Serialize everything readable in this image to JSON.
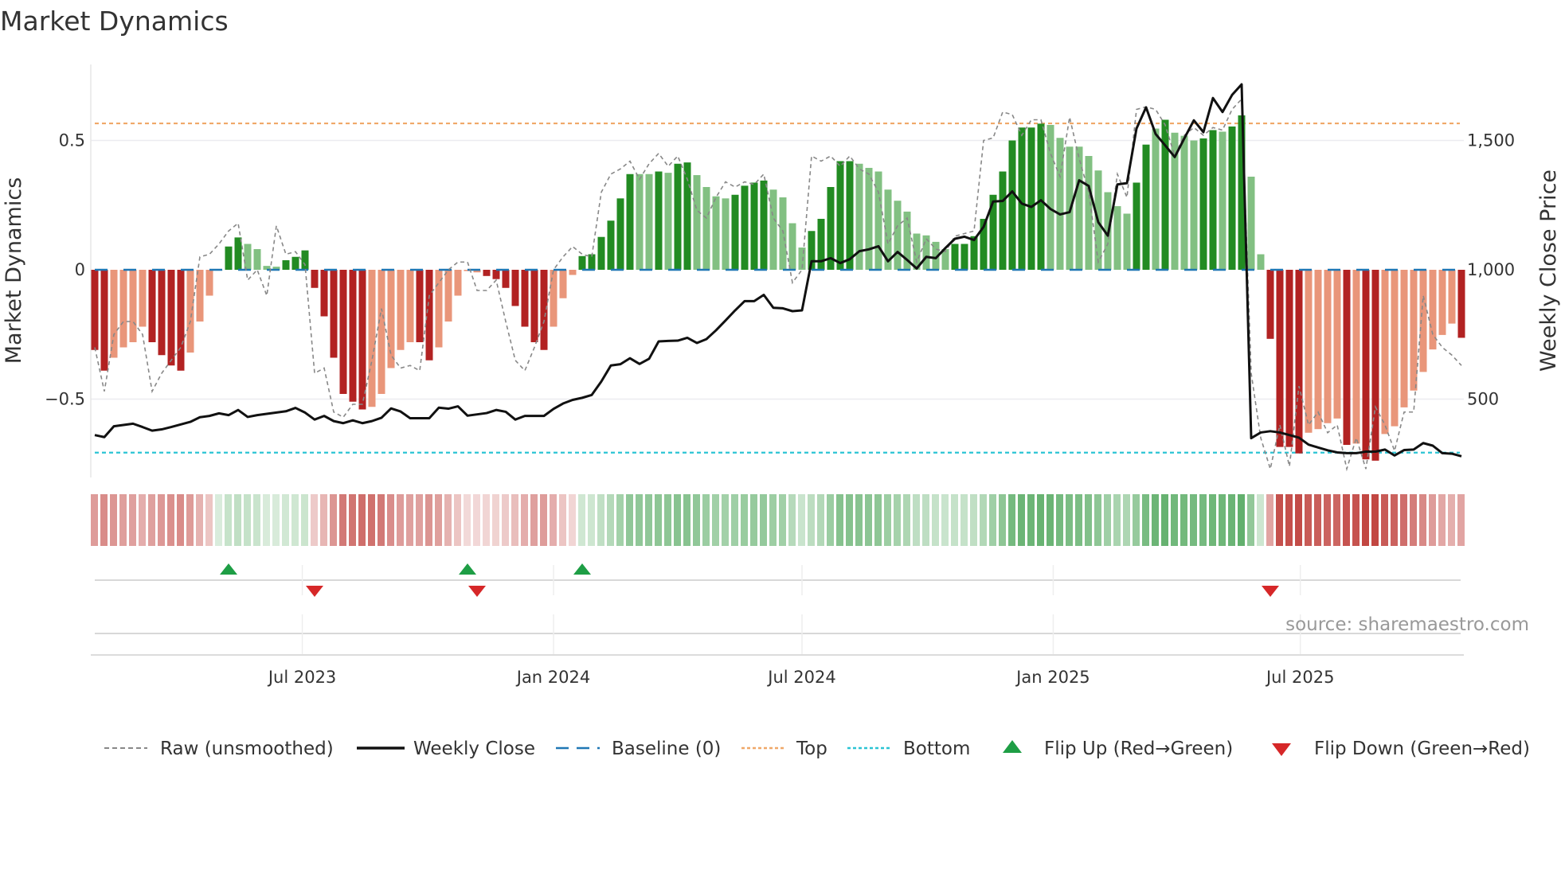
{
  "title": "Market Dynamics",
  "source": "source: sharemaestro.com",
  "chart_data": {
    "type": "bar",
    "title": "Market Dynamics",
    "ylabel": "Market Dynamics",
    "y2label": "Weekly Close Price",
    "ylim": [
      -0.82,
      0.8
    ],
    "y2lim": [
      180,
      1800
    ],
    "yticks": [
      {
        "v": 0.5,
        "label": "0.5"
      },
      {
        "v": 0,
        "label": "0"
      },
      {
        "v": -0.5,
        "label": "−0.5"
      }
    ],
    "y2ticks": [
      {
        "v": 1500,
        "label": "1,500"
      },
      {
        "v": 1000,
        "label": "1,000"
      },
      {
        "v": 500,
        "label": "500"
      }
    ],
    "start_date": "2023-01-30",
    "frequency": "weekly",
    "xticks": [
      {
        "date": "2023-07-01",
        "label": "Jul 2023"
      },
      {
        "date": "2024-01-01",
        "label": "Jan 2024"
      },
      {
        "date": "2024-07-01",
        "label": "Jul 2024"
      },
      {
        "date": "2025-01-01",
        "label": "Jan 2025"
      },
      {
        "date": "2025-07-01",
        "label": "Jul 2025"
      }
    ],
    "top": 0.566,
    "bottom": -0.707,
    "values": [
      -0.31,
      -0.39,
      -0.34,
      -0.3,
      -0.28,
      -0.22,
      -0.28,
      -0.33,
      -0.37,
      -0.39,
      -0.32,
      -0.2,
      -0.1,
      0.0,
      0.09,
      0.125,
      0.1,
      0.08,
      0.015,
      0.012,
      0.037,
      0.05,
      0.075,
      -0.07,
      -0.18,
      -0.34,
      -0.48,
      -0.51,
      -0.54,
      -0.53,
      -0.48,
      -0.38,
      -0.31,
      -0.28,
      -0.28,
      -0.35,
      -0.3,
      -0.2,
      -0.1,
      -0.005,
      -0.01,
      -0.024,
      -0.036,
      -0.07,
      -0.14,
      -0.22,
      -0.28,
      -0.31,
      -0.22,
      -0.11,
      -0.02,
      0.053,
      0.06,
      0.127,
      0.19,
      0.276,
      0.37,
      0.37,
      0.37,
      0.38,
      0.375,
      0.41,
      0.415,
      0.366,
      0.32,
      0.284,
      0.276,
      0.29,
      0.325,
      0.337,
      0.345,
      0.31,
      0.28,
      0.18,
      0.086,
      0.15,
      0.197,
      0.32,
      0.42,
      0.42,
      0.41,
      0.394,
      0.38,
      0.31,
      0.267,
      0.225,
      0.14,
      0.133,
      0.108,
      0.08,
      0.1,
      0.1,
      0.13,
      0.197,
      0.29,
      0.38,
      0.5,
      0.55,
      0.55,
      0.565,
      0.56,
      0.51,
      0.476,
      0.476,
      0.44,
      0.384,
      0.3,
      0.246,
      0.217,
      0.337,
      0.484,
      0.546,
      0.58,
      0.53,
      0.518,
      0.5,
      0.508,
      0.54,
      0.534,
      0.554,
      0.597,
      0.36,
      0.06,
      -0.267,
      -0.685,
      -0.685,
      -0.71,
      -0.63,
      -0.616,
      -0.593,
      -0.575,
      -0.677,
      -0.672,
      -0.733,
      -0.738,
      -0.635,
      -0.605,
      -0.532,
      -0.467,
      -0.395,
      -0.308,
      -0.252,
      -0.208,
      -0.263
    ],
    "strengthening": [
      1,
      1,
      0,
      0,
      0,
      0,
      1,
      1,
      1,
      1,
      0,
      0,
      0,
      0,
      1,
      1,
      0,
      0,
      0,
      0,
      1,
      1,
      1,
      1,
      1,
      1,
      1,
      1,
      1,
      0,
      0,
      0,
      0,
      0,
      1,
      1,
      0,
      0,
      0,
      0,
      0,
      1,
      1,
      1,
      1,
      1,
      1,
      1,
      0,
      0,
      0,
      1,
      1,
      1,
      1,
      1,
      1,
      0,
      0,
      1,
      0,
      1,
      1,
      0,
      0,
      0,
      0,
      1,
      1,
      1,
      1,
      0,
      0,
      0,
      0,
      1,
      1,
      1,
      1,
      1,
      0,
      0,
      0,
      0,
      0,
      0,
      0,
      0,
      0,
      0,
      1,
      1,
      1,
      1,
      1,
      1,
      1,
      1,
      1,
      1,
      0,
      0,
      0,
      0,
      0,
      0,
      0,
      0,
      0,
      1,
      1,
      0,
      1,
      0,
      0,
      0,
      1,
      1,
      0,
      1,
      1,
      0,
      0,
      1,
      1,
      1,
      1,
      0,
      0,
      0,
      0,
      1,
      0,
      1,
      1,
      0,
      0,
      0,
      0,
      0,
      0,
      0,
      0,
      1
    ],
    "raw": [
      -0.3,
      -0.47,
      -0.25,
      -0.2,
      -0.2,
      -0.25,
      -0.47,
      -0.4,
      -0.35,
      -0.3,
      -0.2,
      0.05,
      0.06,
      0.1,
      0.15,
      0.18,
      -0.04,
      0.0,
      -0.1,
      0.17,
      0.06,
      0.07,
      0.02,
      -0.4,
      -0.38,
      -0.55,
      -0.57,
      -0.52,
      -0.52,
      -0.35,
      -0.15,
      -0.33,
      -0.38,
      -0.37,
      -0.39,
      -0.1,
      -0.05,
      0.0,
      0.03,
      0.03,
      -0.08,
      -0.08,
      -0.04,
      -0.2,
      -0.35,
      -0.39,
      -0.3,
      -0.2,
      0.0,
      0.05,
      0.09,
      0.06,
      0.05,
      0.3,
      0.37,
      0.39,
      0.42,
      0.35,
      0.41,
      0.45,
      0.4,
      0.44,
      0.35,
      0.23,
      0.2,
      0.28,
      0.34,
      0.32,
      0.34,
      0.33,
      0.37,
      0.2,
      0.15,
      -0.05,
      0.0,
      0.44,
      0.42,
      0.44,
      0.4,
      0.44,
      0.39,
      0.37,
      0.3,
      0.1,
      0.17,
      0.2,
      0.03,
      0.12,
      0.08,
      0.07,
      0.13,
      0.14,
      0.15,
      0.5,
      0.51,
      0.61,
      0.6,
      0.52,
      0.58,
      0.58,
      0.45,
      0.36,
      0.59,
      0.43,
      0.3,
      0.03,
      0.1,
      0.37,
      0.28,
      0.62,
      0.63,
      0.62,
      0.56,
      0.44,
      0.52,
      0.55,
      0.52,
      0.55,
      0.54,
      0.62,
      0.66,
      -0.4,
      -0.65,
      -0.77,
      -0.6,
      -0.76,
      -0.45,
      -0.6,
      -0.55,
      -0.63,
      -0.6,
      -0.77,
      -0.65,
      -0.77,
      -0.53,
      -0.6,
      -0.7,
      -0.55,
      -0.55,
      -0.1,
      -0.25,
      -0.3,
      -0.33,
      -0.37
    ],
    "close": [
      361,
      353,
      395,
      400,
      405,
      392,
      378,
      383,
      392,
      402,
      412,
      430,
      435,
      445,
      438,
      458,
      431,
      438,
      443,
      448,
      453,
      466,
      448,
      421,
      435,
      415,
      407,
      418,
      407,
      415,
      428,
      464,
      452,
      426,
      426,
      426,
      467,
      463,
      472,
      436,
      441,
      446,
      458,
      451,
      421,
      435,
      435,
      435,
      462,
      483,
      497,
      505,
      516,
      568,
      630,
      635,
      658,
      636,
      656,
      723,
      725,
      726,
      737,
      717,
      732,
      766,
      804,
      843,
      879,
      879,
      903,
      853,
      851,
      840,
      843,
      1033,
      1033,
      1045,
      1026,
      1041,
      1072,
      1079,
      1091,
      1033,
      1069,
      1038,
      1005,
      1050,
      1045,
      1084,
      1120,
      1128,
      1115,
      1166,
      1264,
      1266,
      1303,
      1256,
      1243,
      1269,
      1235,
      1214,
      1223,
      1346,
      1324,
      1184,
      1132,
      1330,
      1335,
      1546,
      1628,
      1525,
      1481,
      1436,
      1508,
      1578,
      1532,
      1664,
      1610,
      1676,
      1717,
      349,
      371,
      376,
      371,
      361,
      351,
      324,
      313,
      302,
      294,
      291,
      291,
      297,
      297,
      305,
      282,
      303,
      305,
      330,
      320,
      291,
      289,
      279
    ],
    "flip_up_weeks": [
      14,
      39,
      51
    ],
    "flip_down_weeks": [
      23,
      40,
      123
    ],
    "colors": {
      "pos_strong": "#228b22",
      "pos_weak": "#82c082",
      "neg_strong": "#b22222",
      "neg_weak": "#e9967a",
      "raw": "#888888",
      "close": "#111111",
      "baseline": "#1f77b4",
      "top": "#f0a868",
      "bottom": "#2bc4d4",
      "flip_up": "#1e9e45",
      "flip_down": "#d62728"
    },
    "legend": [
      {
        "key": "raw",
        "label": "Raw (unsmoothed)"
      },
      {
        "key": "close",
        "label": "Weekly Close"
      },
      {
        "key": "baseline",
        "label": "Baseline (0)"
      },
      {
        "key": "top",
        "label": "Top"
      },
      {
        "key": "bottom",
        "label": "Bottom"
      },
      {
        "key": "flip_up",
        "label": "Flip Up (Red→Green)"
      },
      {
        "key": "flip_down",
        "label": "Flip Down (Green→Red)"
      }
    ],
    "legend_position": "bottom"
  }
}
